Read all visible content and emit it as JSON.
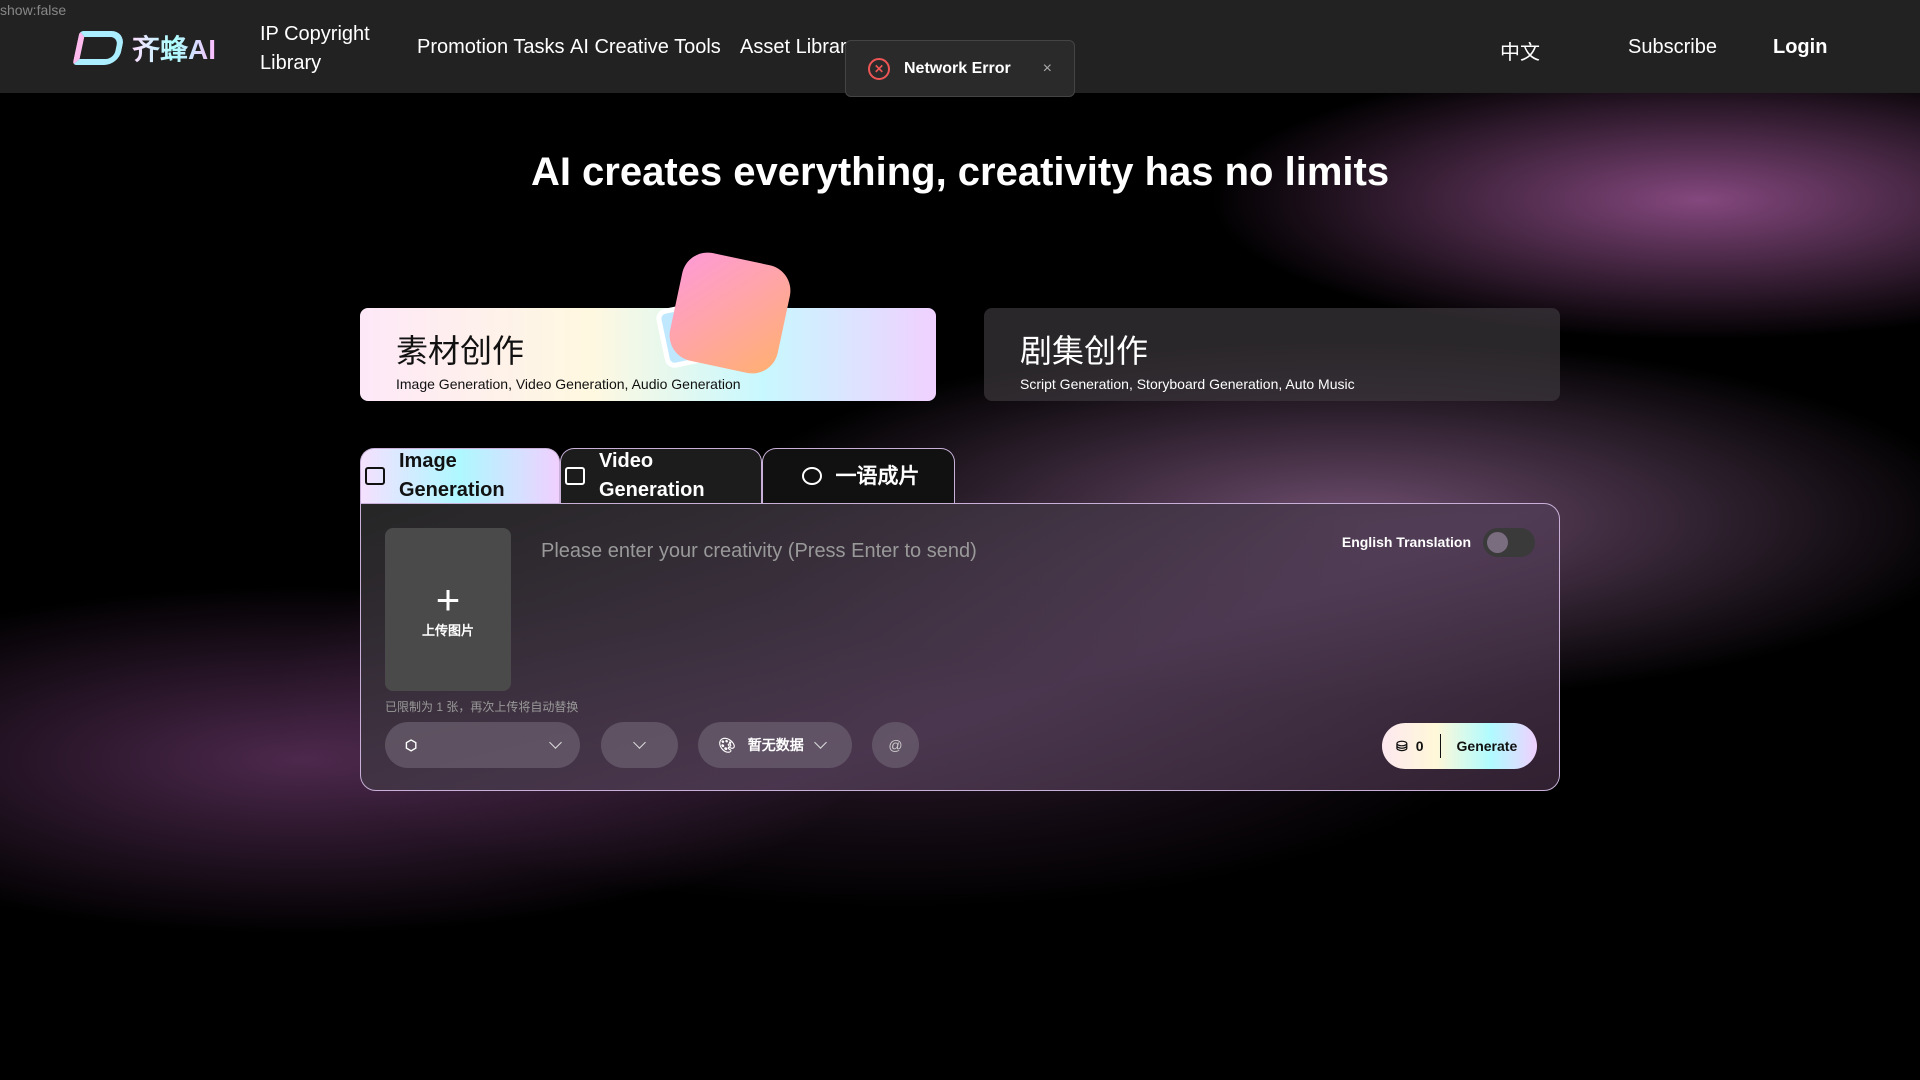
{
  "debug_text": "show:false",
  "nav": {
    "logo_text": "齐蜂AI",
    "items": [
      "IP Copyright Library",
      "Promotion Tasks",
      "AI Creative Tools",
      "Asset Library"
    ],
    "language": "中文",
    "subscribe": "Subscribe",
    "login": "Login"
  },
  "toast": {
    "message": "Network Error",
    "close": "×"
  },
  "hero": {
    "title": "AI creates everything, creativity has no limits"
  },
  "cards": [
    {
      "title": "素材创作",
      "subtitle": "Image Generation, Video Generation, Audio Generation"
    },
    {
      "title": "剧集创作",
      "subtitle": "Script Generation, Storyboard Generation, Auto Music"
    }
  ],
  "tabs": [
    {
      "label": "Image Generation"
    },
    {
      "label": "Video Generation"
    },
    {
      "label": "一语成片"
    }
  ],
  "panel": {
    "upload_label": "上传图片",
    "prompt_placeholder": "Please enter your creativity (Press Enter to send)",
    "upload_hint": "已限制为 1 张，再次上传将自动替换",
    "translation_label": "English Translation",
    "translation_on": false,
    "style_select": "暂无数据",
    "at_button": "@",
    "credits": "0",
    "generate": "Generate"
  }
}
